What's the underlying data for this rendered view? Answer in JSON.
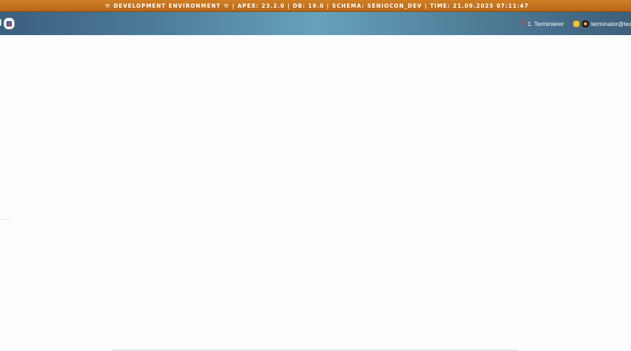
{
  "env_banner": {
    "icon": "hammer-wrench-icon",
    "label": "DEVELOPMENT ENVIRONMENT",
    "info": "| APEX: 23.2.0 | DB: 19.0 | SCHEMA: SENIOCON_DEV | TIME: 21.09.2025 07:11:47",
    "color": "#c67520"
  },
  "header": {
    "home_icon": "home-icon",
    "phone": {
      "icon": "phone-icon",
      "label": "1. Terminierer"
    },
    "user": {
      "icons": [
        "smile-icon",
        "gear-icon"
      ],
      "label": "terminator@test."
    },
    "gradient_colors": [
      "#3b5f7e",
      "#66a2ba"
    ]
  }
}
